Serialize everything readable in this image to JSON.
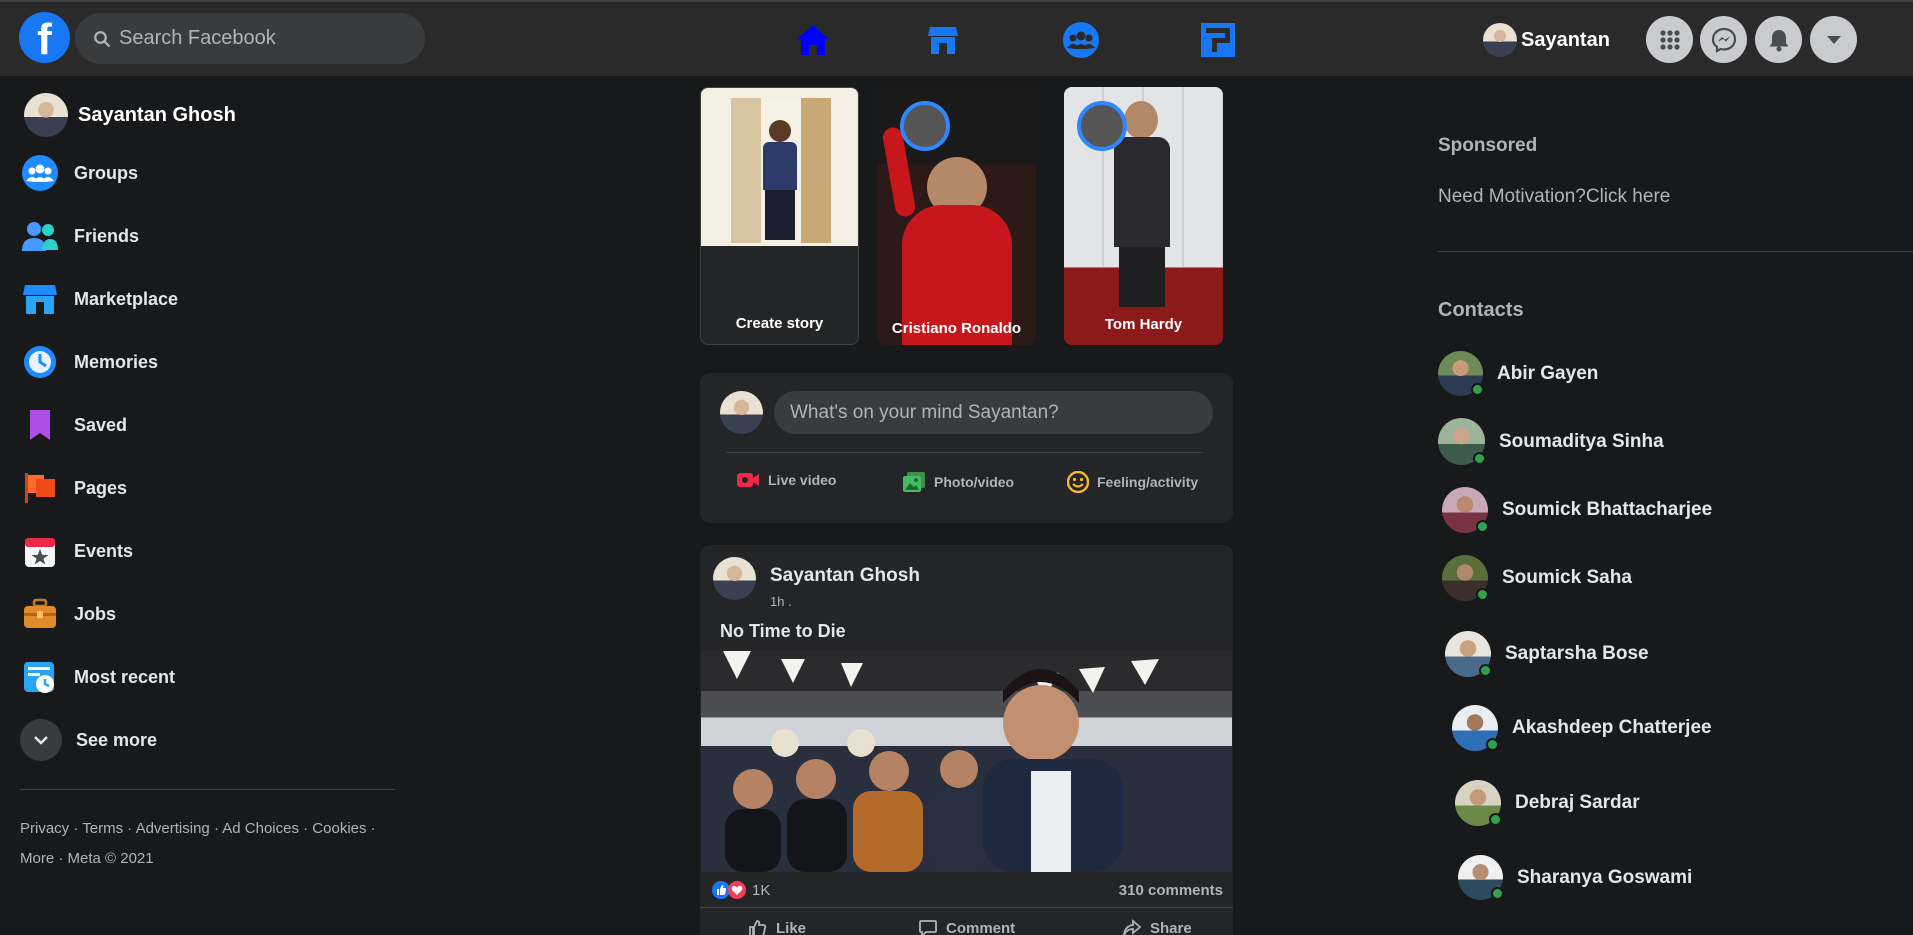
{
  "colors": {
    "accent": "#1877f2",
    "background": "#18191a",
    "card": "#242526",
    "topbar": "#2a2a2a",
    "online": "#31a24c"
  },
  "header": {
    "logo_letter": "f",
    "search_placeholder": "Search Facebook",
    "nav_icons": [
      "home-icon",
      "marketplace-icon",
      "groups-icon",
      "gaming-icon"
    ],
    "profile_name": "Sayantan",
    "action_icons": [
      "menu-grid-icon",
      "messenger-icon",
      "notifications-bell-icon",
      "account-dropdown-icon"
    ]
  },
  "sidebar": {
    "profile_name": "Sayantan Ghosh",
    "items": [
      {
        "label": "Friends",
        "icon": "friends-icon"
      },
      {
        "label": "Groups",
        "icon": "groups-icon"
      },
      {
        "label": "Marketplace",
        "icon": "marketplace-icon"
      },
      {
        "label": "Memories",
        "icon": "memories-icon"
      },
      {
        "label": "Saved",
        "icon": "saved-icon"
      },
      {
        "label": "Pages",
        "icon": "pages-icon"
      },
      {
        "label": "Events",
        "icon": "events-icon"
      },
      {
        "label": "Jobs",
        "icon": "jobs-icon"
      },
      {
        "label": "Most recent",
        "icon": "most-recent-icon"
      },
      {
        "label": "See more",
        "icon": "chevron-down-icon"
      }
    ],
    "footer_line1": "Privacy · Terms · Advertising · Ad Choices · Cookies ·",
    "footer_line2": "More · Meta © 2021"
  },
  "stories": [
    {
      "label": "Create story"
    },
    {
      "label": "Cristiano Ronaldo"
    },
    {
      "label": "Tom Hardy"
    }
  ],
  "composer": {
    "placeholder": "What's on your mind Sayantan?",
    "actions": [
      {
        "label": "Live video",
        "icon": "live-video-icon"
      },
      {
        "label": "Photo/video",
        "icon": "photo-video-icon"
      },
      {
        "label": "Feeling/activity",
        "icon": "feeling-activity-icon"
      }
    ]
  },
  "post": {
    "author": "Sayantan Ghosh",
    "time": "1h .",
    "text": "No Time to Die",
    "reaction_count": "1K",
    "comments": "310 comments",
    "actions": [
      "Like",
      "Comment",
      "Share"
    ]
  },
  "right": {
    "sponsored_title": "Sponsored",
    "ad_text": "Need Motivation?Click here",
    "contacts_title": "Contacts",
    "contacts": [
      "Abir Gayen",
      "Soumaditya Sinha",
      "Soumick Bhattacharjee",
      "Soumick Saha",
      "Saptarsha Bose",
      "Akashdeep Chatterjee",
      "Debraj Sardar",
      "Sharanya Goswami"
    ]
  }
}
